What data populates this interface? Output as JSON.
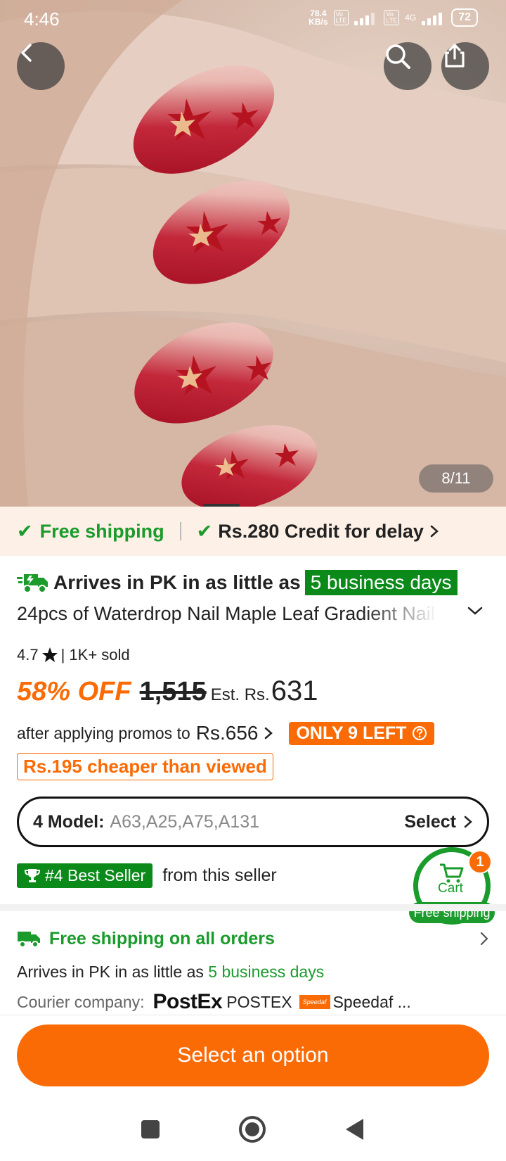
{
  "status_bar": {
    "time": "4:46",
    "net_speed_value": "78.4",
    "net_speed_unit": "KB/s",
    "network_label": "4G",
    "battery": "72"
  },
  "hero": {
    "page_counter": "8/11"
  },
  "shipping_banner": {
    "free_shipping": "Free shipping",
    "credit": "Rs.280 Credit for delay"
  },
  "product": {
    "arrives_prefix": "Arrives in PK in as little as",
    "arrives_days": "5 business days",
    "title": "24pcs of Waterdrop Nail Maple Leaf Gradient Nail",
    "rating": "4.7",
    "sold": "| 1K+ sold",
    "discount": "58% OFF",
    "original_price": "1,515",
    "est_label": "Est. Rs.",
    "est_price": "631",
    "promo_prefix": "after applying promos to",
    "promo_price": "Rs.656",
    "stock_badge": "ONLY 9 LEFT",
    "cheaper_badge": "Rs.195 cheaper than viewed"
  },
  "model_selector": {
    "label": "4 Model:",
    "value": "A63,A25,A75,A131",
    "action": "Select"
  },
  "best_seller": {
    "badge": "#4 Best Seller",
    "suffix": "from this seller"
  },
  "cart": {
    "label": "Cart",
    "count": "1",
    "free_shipping": "Free shipping"
  },
  "shipping_info": {
    "title": "Free shipping on all orders",
    "arrives_prefix": "Arrives in PK in as little as",
    "arrives_days": "5 business days",
    "courier_label": "Courier company:",
    "courier_logo_1": "PostEx",
    "courier_name_1": "POSTEX",
    "courier_logo_2": "Speedaf",
    "courier_name_2": "Speedaf ..."
  },
  "cta": {
    "label": "Select an option"
  },
  "colors": {
    "accent_orange": "#fa6b06",
    "green": "#1a9b2c",
    "dark_green": "#0b8a1a"
  }
}
